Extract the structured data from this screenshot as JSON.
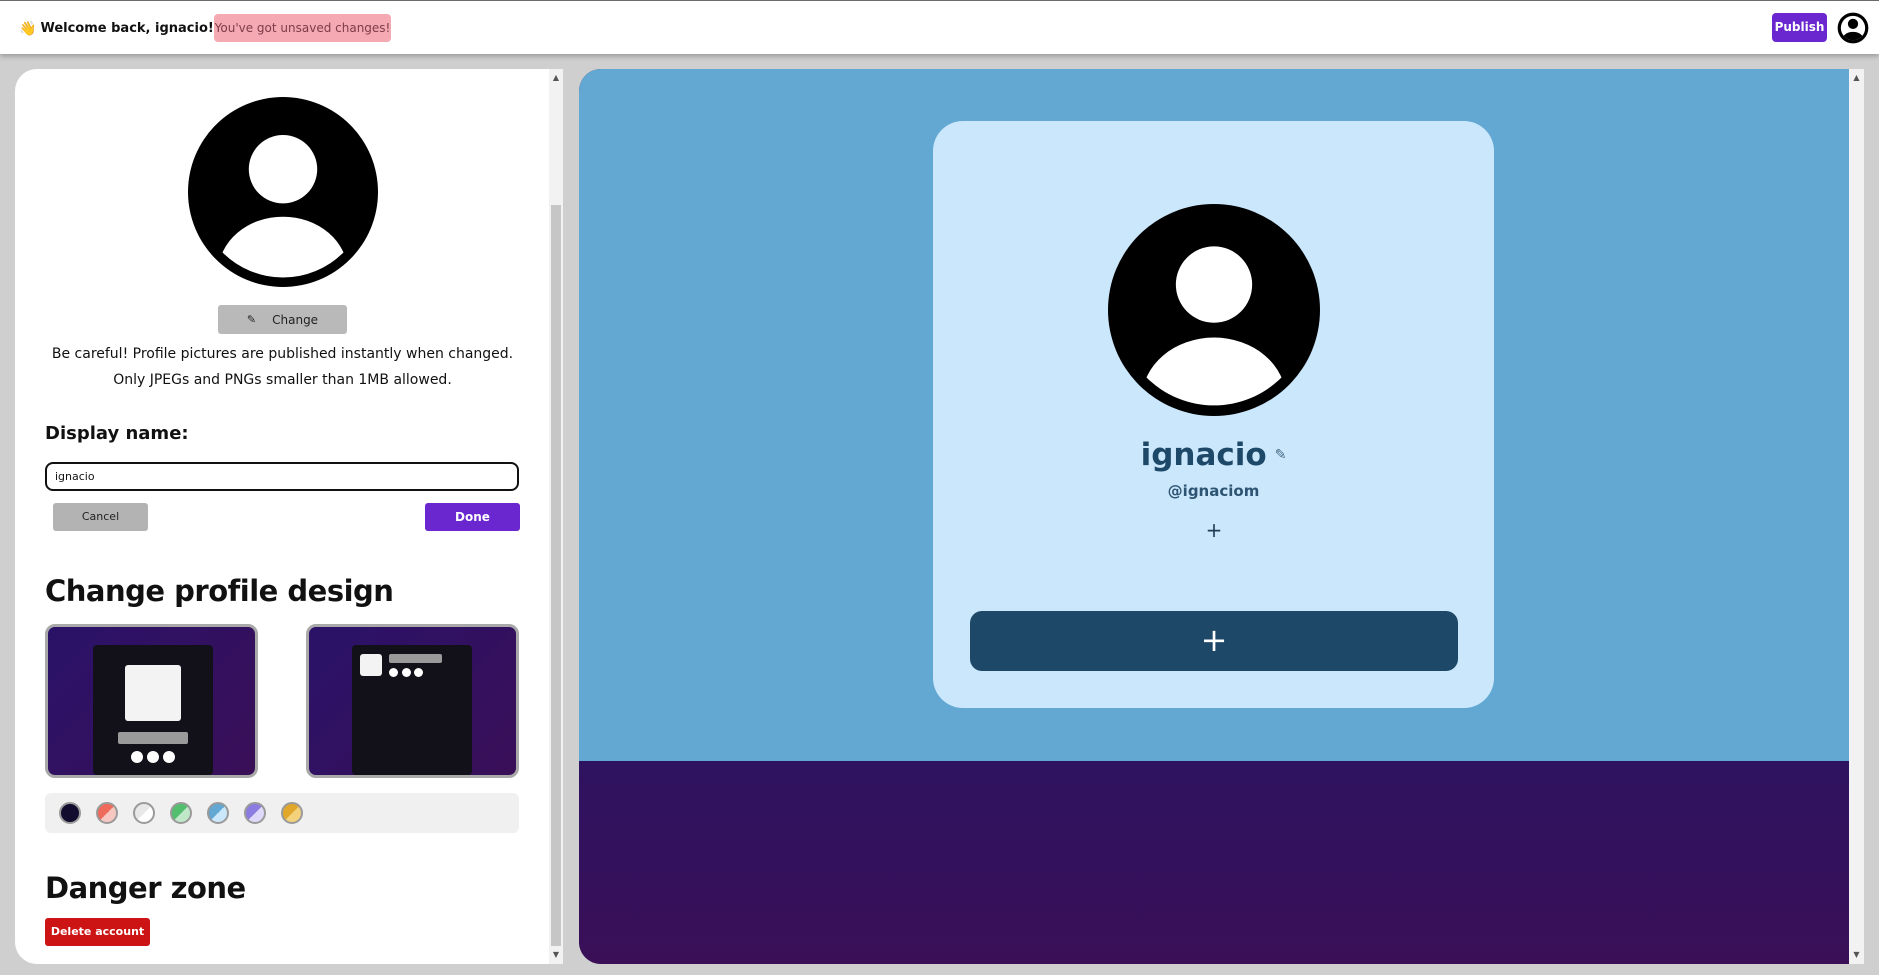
{
  "header": {
    "wave_emoji": "👋",
    "welcome": "Welcome back, ignacio!",
    "unsaved": "You've got unsaved changes!",
    "publish": "Publish",
    "user_icon": "user-circle-icon"
  },
  "editor": {
    "avatar_icon": "user-circle-icon",
    "change_icon": "pencil-icon",
    "change_label": "Change",
    "warning_line1": "Be careful! Profile pictures are published instantly when changed.",
    "warning_line2": "Only JPEGs and PNGs smaller than 1MB allowed.",
    "display_name_label": "Display name:",
    "display_name_value": "ignacio",
    "cancel_label": "Cancel",
    "done_label": "Done",
    "design_title": "Change profile design",
    "designs": [
      "centered",
      "compact"
    ],
    "swatches": [
      {
        "name": "dark",
        "colors": [
          "#120d2e",
          "#120d2e"
        ]
      },
      {
        "name": "coral",
        "colors": [
          "#ee6a5a",
          "#f7c8c1"
        ]
      },
      {
        "name": "white",
        "colors": [
          "#e8e8e8",
          "#ffffff"
        ]
      },
      {
        "name": "green",
        "colors": [
          "#52be6e",
          "#bfe8c9"
        ]
      },
      {
        "name": "blue",
        "colors": [
          "#62a8d3",
          "#cbe7fb"
        ]
      },
      {
        "name": "lavender",
        "colors": [
          "#8a7ce0",
          "#ded8fb"
        ]
      },
      {
        "name": "yellow",
        "colors": [
          "#e0a72a",
          "#f3d27b"
        ]
      }
    ],
    "danger_title": "Danger zone",
    "delete_label": "Delete account"
  },
  "preview": {
    "avatar_icon": "user-circle-icon",
    "name": "ignacio",
    "name_edit_icon": "pencil-icon",
    "handle": "@ignaciom",
    "add_social_icon": "plus-icon",
    "add_link_icon": "plus-icon",
    "colors": {
      "background": "#62a8d3",
      "card": "#cbe7fb",
      "accent": "#1d4868",
      "page_bottom": "#2e1360"
    }
  },
  "colors": {
    "brand_purple": "#6a26cf",
    "danger_red": "#cc1414",
    "unsaved_pink": "#f4a9b3"
  }
}
